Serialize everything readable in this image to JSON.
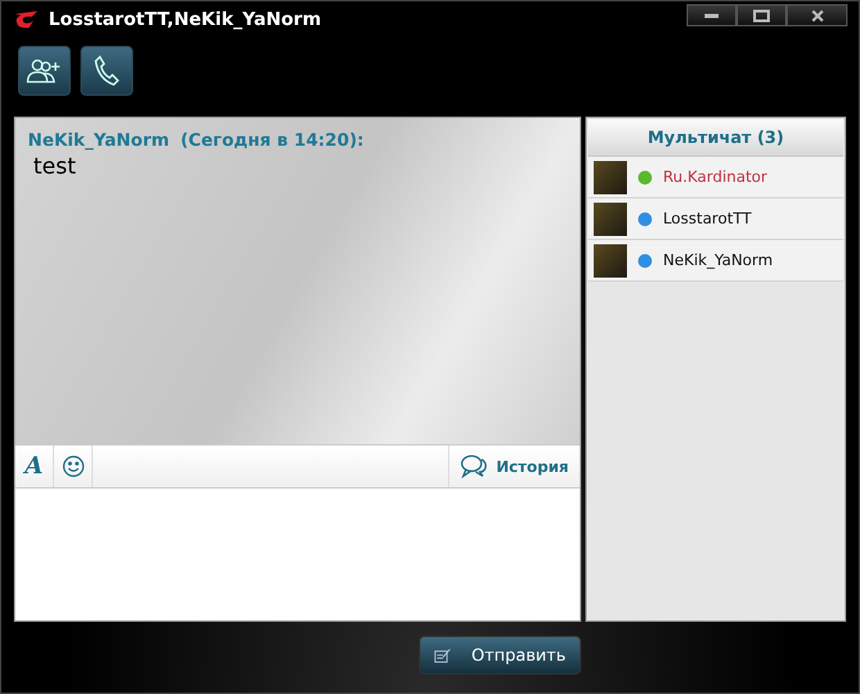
{
  "window": {
    "title": "LosstarotTT,NeKik_YaNorm"
  },
  "messages": [
    {
      "author": "NeKik_YaNorm",
      "time": "(Сегодня в 14:20):",
      "text": "test"
    }
  ],
  "format_bar": {
    "font_glyph": "A",
    "history": "История"
  },
  "members": {
    "title": "Мультичат (3)",
    "items": [
      {
        "name": "Ru.Kardinator",
        "color": "#5cb82e",
        "highlighted": true
      },
      {
        "name": "LosstarotTT",
        "color": "#2f8fe0",
        "highlighted": false
      },
      {
        "name": "NeKik_YaNorm",
        "color": "#2f8fe0",
        "highlighted": false
      }
    ]
  },
  "send_button": "Отправить"
}
